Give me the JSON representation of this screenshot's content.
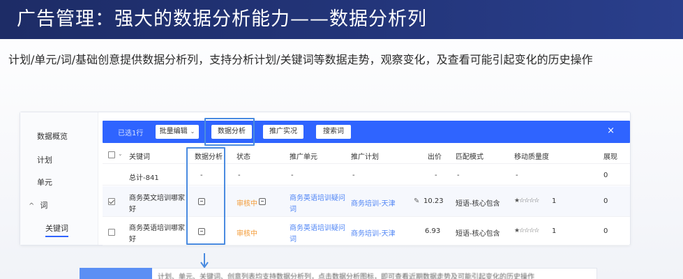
{
  "banner": {
    "title": "广告管理：强大的数据分析能力——数据分析列"
  },
  "subtitle": "计划/单元/词/基础创意提供数据分析列，支持分析计划/关键词等数据走势，观察变化，及查看可能引起变化的历史操作",
  "sidebar": {
    "items": [
      {
        "label": "数据概览"
      },
      {
        "label": "计划"
      },
      {
        "label": "单元"
      },
      {
        "label": "词",
        "chevron": "^"
      },
      {
        "label": "关键词"
      }
    ]
  },
  "toolbar": {
    "selected_label": "已选1行",
    "batch_edit": "批量编辑",
    "batch_chevron": "⌄",
    "data_analysis": "数据分析",
    "promote_live": "推广实况",
    "search_terms": "搜索词",
    "close": "×"
  },
  "table": {
    "columns": [
      "关键词",
      "数据分析",
      "状态",
      "推广单元",
      "推广计划",
      "出价",
      "匹配模式",
      "移动质量度",
      "展现"
    ],
    "total_row": {
      "keyword": "总计-841",
      "analysis": "-",
      "status": "-",
      "unit": "-",
      "plan": "-",
      "bid": "-",
      "match": "-",
      "quality": "-",
      "impressions": "0"
    },
    "rows": [
      {
        "checked": true,
        "keyword_line1": "商务英文培训哪家",
        "keyword_line2": "好",
        "status": "审核中",
        "unit": "商务英语培训疑问",
        "unit_line2": "词",
        "plan": "商务培训-天津",
        "bid": "10.23",
        "match": "短语-核心包含",
        "quality_stars": "★☆☆☆☆",
        "quality_value": "1",
        "impressions": "0"
      },
      {
        "checked": false,
        "keyword_line1": "商务英语培训哪家",
        "keyword_line2": "好",
        "status": "审核中",
        "unit": "商务英语培训疑问",
        "unit_line2": "词",
        "plan": "商务培训-天津",
        "bid": "6.93",
        "match": "短语-核心包含",
        "quality_stars": "★☆☆☆☆",
        "quality_value": "1",
        "impressions": "0"
      }
    ]
  },
  "bottom_panel": {
    "text": "计划、单元、关键词、创意列表均支持数据分析列，点击数据分析图标，即可查看近期数据走势及可能引起变化的历史操作"
  },
  "colors": {
    "banner": "#1d2c66",
    "toolbar": "#2f64ff",
    "highlight": "#4a8be0",
    "link": "#4f85f5",
    "status_pending": "#f39b37"
  }
}
